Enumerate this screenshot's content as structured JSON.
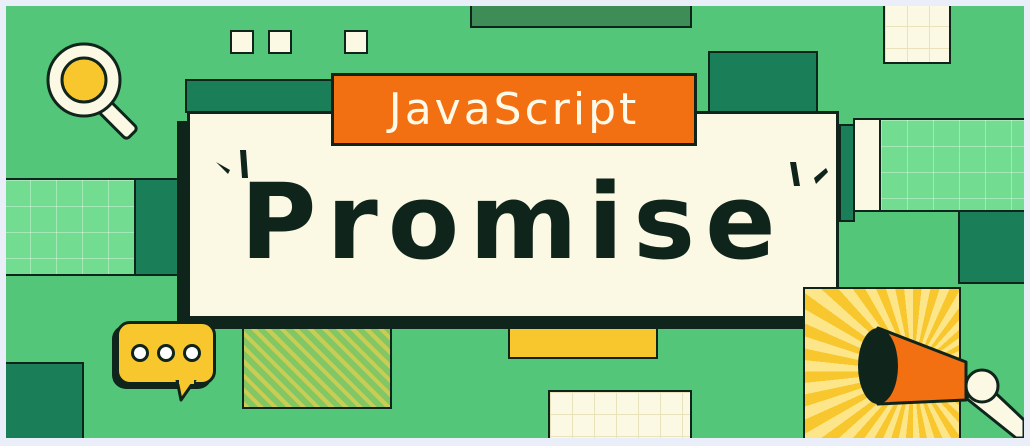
{
  "banner": {
    "tag_label": "JavaScript",
    "title": "Promise"
  },
  "colors": {
    "background": "#53c67a",
    "dark_green": "#1a7e58",
    "light_green": "#72dc91",
    "cream": "#fbf8e4",
    "orange": "#f27011",
    "yellow": "#f8c72e",
    "outline": "#0f241b"
  },
  "decorations": {
    "top_left_icon": "magnifier-icon",
    "bottom_left_icon": "chat-bubble-icon",
    "bottom_right_icon": "megaphone-icon"
  }
}
